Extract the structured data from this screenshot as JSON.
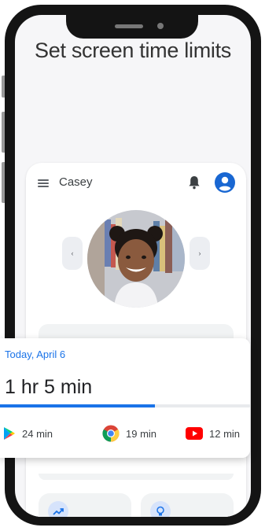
{
  "headline": "Set screen time limits",
  "header": {
    "child_name": "Casey",
    "menu_icon": "menu-icon",
    "notification_icon": "bell-icon",
    "account_icon": "account-circle-icon"
  },
  "profile": {
    "prev_label": "‹",
    "next_label": "›"
  },
  "summary": {
    "date": "Today, April 6",
    "total_time": "1 hr 5 min",
    "progress": 0.62,
    "apps": [
      {
        "icon": "google-play-icon",
        "time": "24 min"
      },
      {
        "icon": "chrome-icon",
        "time": "19 min"
      },
      {
        "icon": "youtube-icon",
        "time": "12 min"
      }
    ]
  },
  "tiles": [
    {
      "icon": "trending-up-icon"
    },
    {
      "icon": "lightbulb-icon"
    }
  ],
  "colors": {
    "accent": "#1a73e8",
    "text_primary": "#202124",
    "frame": "#141414"
  }
}
